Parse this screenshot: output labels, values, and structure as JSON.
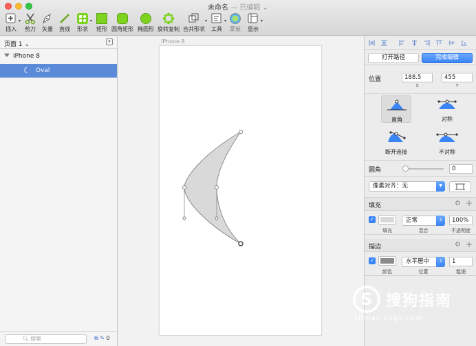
{
  "window": {
    "title": "未命名",
    "status": "— 已编辑",
    "caret": "⌄"
  },
  "toolbar": {
    "items": [
      {
        "label": "插入",
        "icon": "plus-box-icon"
      },
      {
        "label": "剪刀",
        "icon": "scissors-icon"
      },
      {
        "label": "矢量",
        "icon": "pen-icon"
      },
      {
        "label": "直线",
        "icon": "line-icon"
      },
      {
        "label": "形状",
        "icon": "shapes-icon"
      },
      {
        "label": "矩形",
        "icon": "rectangle-icon"
      },
      {
        "label": "圆角矩形",
        "icon": "rounded-rectangle-icon"
      },
      {
        "label": "椭圆形",
        "icon": "oval-icon"
      },
      {
        "label": "旋转复制",
        "icon": "rotate-copy-icon"
      },
      {
        "label": "合并形状",
        "icon": "combine-shapes-icon"
      },
      {
        "label": "工具",
        "icon": "tools-icon"
      },
      {
        "label": "蒙板",
        "icon": "mask-icon"
      },
      {
        "label": "显示",
        "icon": "view-icon"
      }
    ],
    "accent": "#7ed321"
  },
  "sidebar": {
    "page_selector": "页面 1",
    "page_caret": "⌄",
    "artboard_name": "iPhone 8",
    "layer_name": "Oval",
    "layer_icon": "crescent-moon-icon",
    "search_placeholder": "搜索",
    "selection_count": "0",
    "selected_color": "#5b8ad8"
  },
  "canvas": {
    "artboard_label": "iPhone 8"
  },
  "inspector": {
    "open_path_label": "打开路径",
    "finish_edit_label": "完成编辑",
    "position_label": "位置",
    "x_value": "188.5",
    "x_caption": "X",
    "y_value": "455",
    "y_caption": "Y",
    "corner_types": [
      {
        "label": "直角",
        "selected": true
      },
      {
        "label": "对称",
        "selected": false
      },
      {
        "label": "断开连接",
        "selected": false
      },
      {
        "label": "不对称",
        "selected": false
      }
    ],
    "radius_label": "圆角",
    "radius_value": "0",
    "radius_slider_value": 0,
    "snap_label": "像素对齐：无",
    "fill_section": "填充",
    "fill_caption": "填充",
    "fill_blend": "正常",
    "blend_caption": "混合",
    "fill_opacity": "100%",
    "opacity_caption": "不透明度",
    "fill_color": "#d9d9d9",
    "border_section": "描边",
    "border_color_caption": "颜色",
    "border_position": "水平居中",
    "position_caption": "位置",
    "border_width": "1",
    "width_caption": "粗细",
    "border_color": "#8a8a8a",
    "accent": "#3a84f5"
  },
  "watermark": {
    "logo": "S",
    "text": "搜狗指南",
    "url": "zhinan.sogo.com"
  }
}
